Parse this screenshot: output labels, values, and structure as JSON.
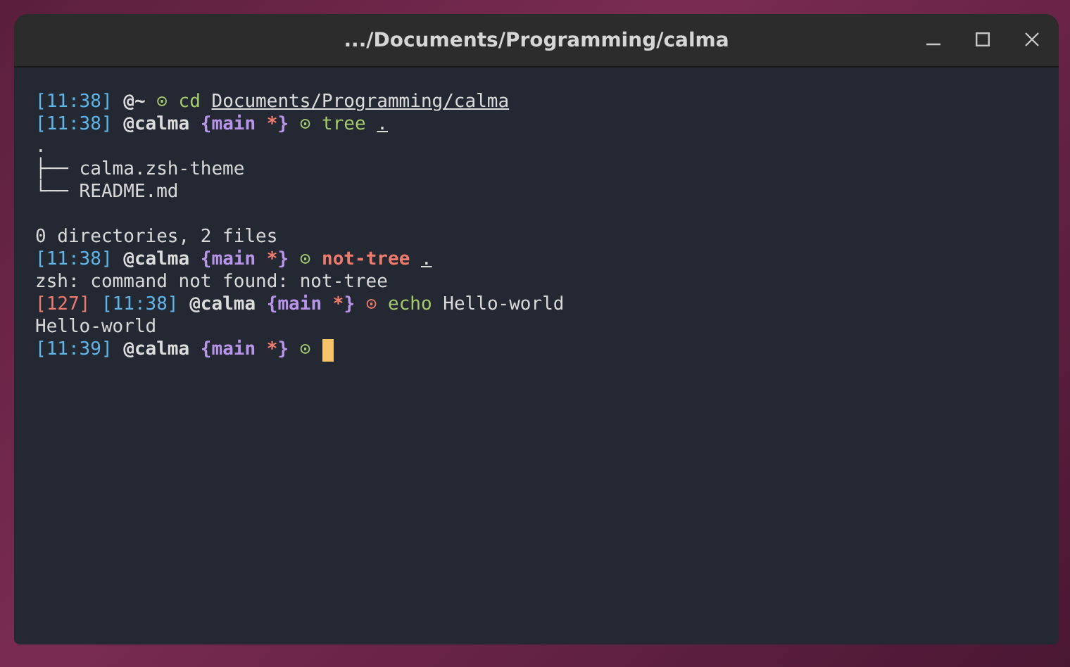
{
  "window": {
    "title": ".../Documents/Programming/calma"
  },
  "terminal": {
    "lines": [
      {
        "kind": "text",
        "words": [
          {
            "parts": [
              {
                "kind": "time",
                "text": "[11:38]"
              }
            ]
          },
          {
            "parts": [
              {
                "kind": "dir",
                "text": "@~"
              }
            ]
          },
          {
            "parts": [
              {
                "kind": "prompt_ok",
                "text": "⊙"
              }
            ]
          },
          {
            "parts": [
              {
                "kind": "command_ok",
                "text": "cd"
              }
            ]
          },
          {
            "parts": [
              {
                "kind": "path",
                "text": "Documents/Programming/calma"
              }
            ]
          }
        ]
      },
      {
        "kind": "text",
        "words": [
          {
            "parts": [
              {
                "kind": "time",
                "text": "[11:38]"
              }
            ]
          },
          {
            "parts": [
              {
                "kind": "dir",
                "text": "@calma"
              }
            ]
          },
          {
            "parts": [
              {
                "kind": "branch",
                "text": "{main"
              }
            ]
          },
          {
            "parts": [
              {
                "kind": "dirty",
                "text": "*"
              },
              {
                "kind": "branch",
                "text": "}"
              }
            ]
          },
          {
            "parts": [
              {
                "kind": "prompt_ok",
                "text": "⊙"
              }
            ]
          },
          {
            "parts": [
              {
                "kind": "command_ok",
                "text": "tree"
              }
            ]
          },
          {
            "parts": [
              {
                "kind": "path",
                "text": "."
              }
            ]
          }
        ]
      },
      {
        "kind": "text",
        "words": [
          {
            "parts": [
              {
                "kind": "output",
                "text": "."
              }
            ]
          }
        ]
      },
      {
        "kind": "text",
        "words": [
          {
            "parts": [
              {
                "kind": "output",
                "text": "├── calma.zsh-theme"
              }
            ]
          }
        ]
      },
      {
        "kind": "text",
        "words": [
          {
            "parts": [
              {
                "kind": "output",
                "text": "└── README.md"
              }
            ]
          }
        ]
      },
      {
        "kind": "blank"
      },
      {
        "kind": "text",
        "words": [
          {
            "parts": [
              {
                "kind": "output",
                "text": "0 directories, 2 files"
              }
            ]
          }
        ]
      },
      {
        "kind": "text",
        "words": [
          {
            "parts": [
              {
                "kind": "time",
                "text": "[11:38]"
              }
            ]
          },
          {
            "parts": [
              {
                "kind": "dir",
                "text": "@calma"
              }
            ]
          },
          {
            "parts": [
              {
                "kind": "branch",
                "text": "{main"
              }
            ]
          },
          {
            "parts": [
              {
                "kind": "dirty",
                "text": "*"
              },
              {
                "kind": "branch",
                "text": "}"
              }
            ]
          },
          {
            "parts": [
              {
                "kind": "prompt_ok",
                "text": "⊙"
              }
            ]
          },
          {
            "parts": [
              {
                "kind": "command_bad",
                "text": "not-tree"
              }
            ]
          },
          {
            "parts": [
              {
                "kind": "path",
                "text": "."
              }
            ]
          }
        ]
      },
      {
        "kind": "text",
        "words": [
          {
            "parts": [
              {
                "kind": "output",
                "text": "zsh: command not found: not-tree"
              }
            ]
          }
        ]
      },
      {
        "kind": "text",
        "words": [
          {
            "parts": [
              {
                "kind": "exit_code",
                "text": "[127]"
              }
            ]
          },
          {
            "parts": [
              {
                "kind": "time",
                "text": "[11:38]"
              }
            ]
          },
          {
            "parts": [
              {
                "kind": "dir",
                "text": "@calma"
              }
            ]
          },
          {
            "parts": [
              {
                "kind": "branch",
                "text": "{main"
              }
            ]
          },
          {
            "parts": [
              {
                "kind": "dirty",
                "text": "*"
              },
              {
                "kind": "branch",
                "text": "}"
              }
            ]
          },
          {
            "parts": [
              {
                "kind": "prompt_err",
                "text": "⊙"
              }
            ]
          },
          {
            "parts": [
              {
                "kind": "command_ok",
                "text": "echo"
              }
            ]
          },
          {
            "parts": [
              {
                "kind": "output",
                "text": "Hello-world"
              }
            ]
          }
        ]
      },
      {
        "kind": "text",
        "words": [
          {
            "parts": [
              {
                "kind": "output",
                "text": "Hello-world"
              }
            ]
          }
        ]
      },
      {
        "kind": "text",
        "words": [
          {
            "parts": [
              {
                "kind": "time",
                "text": "[11:39]"
              }
            ]
          },
          {
            "parts": [
              {
                "kind": "dir",
                "text": "@calma"
              }
            ]
          },
          {
            "parts": [
              {
                "kind": "branch",
                "text": "{main"
              }
            ]
          },
          {
            "parts": [
              {
                "kind": "dirty",
                "text": "*"
              },
              {
                "kind": "branch",
                "text": "}"
              }
            ]
          },
          {
            "parts": [
              {
                "kind": "prompt_ok",
                "text": "⊙"
              }
            ]
          },
          {
            "parts": [
              {
                "kind": "cursor"
              }
            ]
          }
        ]
      }
    ]
  }
}
